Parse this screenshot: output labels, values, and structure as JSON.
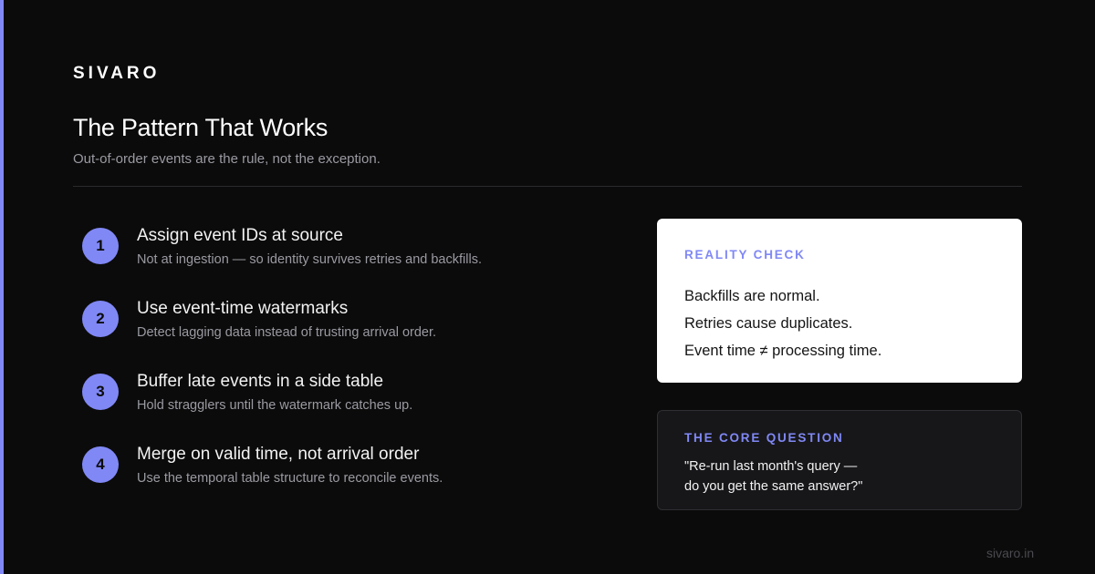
{
  "brand": {
    "name": "SIVARO",
    "accent_color": "#8088f5"
  },
  "header": {
    "title": "The Pattern That Works",
    "subtitle": "Out-of-order events are the rule, not the exception."
  },
  "steps": [
    {
      "number": "1",
      "title": "Assign event IDs at source",
      "description": "Not at ingestion — so identity survives retries and backfills."
    },
    {
      "number": "2",
      "title": "Use event-time watermarks",
      "description": "Detect lagging data instead of trusting arrival order."
    },
    {
      "number": "3",
      "title": "Buffer late events in a side table",
      "description": "Hold stragglers until the watermark catches up."
    },
    {
      "number": "4",
      "title": "Merge on valid time, not arrival order",
      "description": "Use the temporal table structure to reconcile events."
    }
  ],
  "reality_check": {
    "label": "REALITY CHECK",
    "lines": [
      "Backfills are normal.",
      "Retries cause duplicates.",
      "Event time ≠ processing time."
    ]
  },
  "core_question": {
    "label": "THE CORE QUESTION",
    "lines": [
      "\"Re-run last month's query —",
      "do you get the same answer?\""
    ]
  },
  "footer": {
    "url": "sivaro.in"
  },
  "colors": {
    "background": "#0b0b0b",
    "accent": "#8088f5",
    "card_light": "#ffffff",
    "card_dark": "#17171a",
    "muted_text": "#9a9aa2"
  }
}
